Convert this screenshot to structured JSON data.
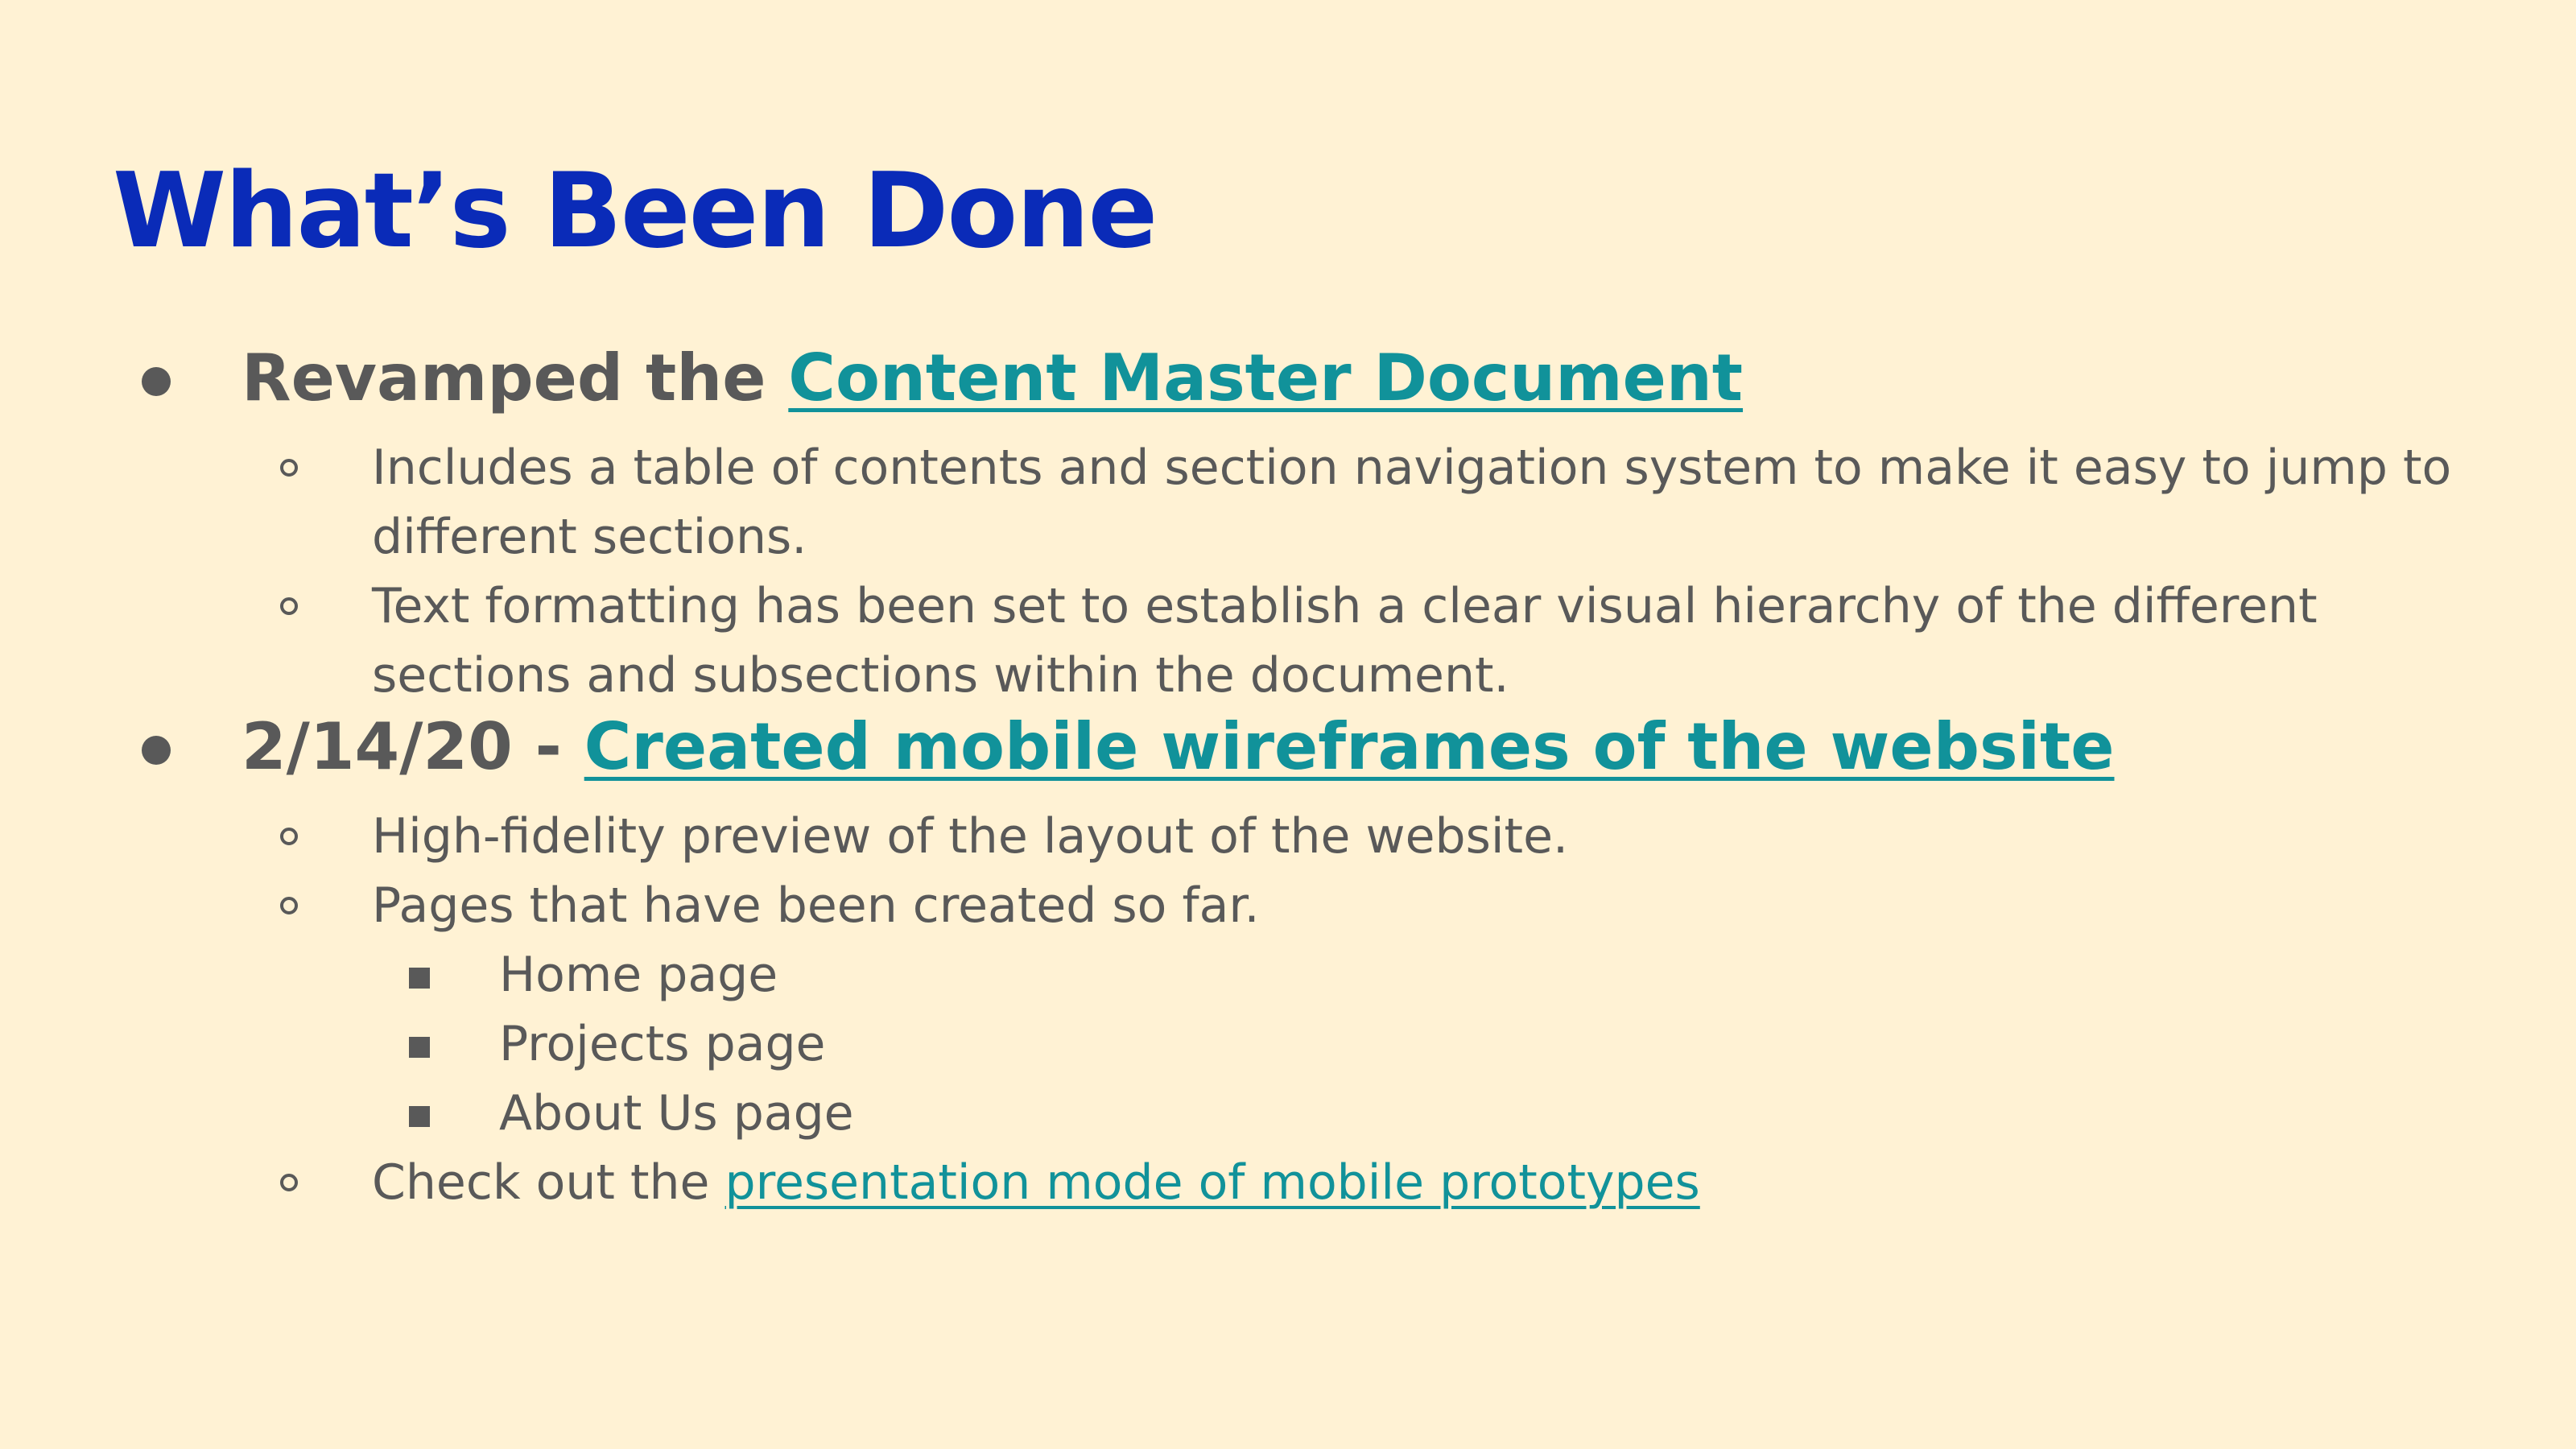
{
  "slide": {
    "title": "What’s Been Done",
    "bullets": [
      {
        "prefix": "Revamped the ",
        "link": "Content Master Document",
        "subs": [
          "Includes a table of contents and section navigation system to make it easy to jump to different sections.",
          "Text formatting has been set to establish a clear visual hierarchy of the different sections and subsections within the document."
        ]
      },
      {
        "prefix": "2/14/20 - ",
        "link": "Created mobile wireframes of the website",
        "subs": [
          "High-fidelity preview of the layout of the website.",
          "Pages that have been created so far."
        ],
        "pages": [
          "Home page",
          "Projects page",
          "About Us page"
        ],
        "last_sub_prefix": "Check out the ",
        "last_sub_link": "presentation mode of mobile prototypes"
      }
    ]
  },
  "colors": {
    "background": "#fff2d4",
    "title": "#0a2bb8",
    "body_text": "#595959",
    "link": "#11929a"
  },
  "icons": {
    "level1_marker": "filled-circle-bullet",
    "level2_marker": "hollow-circle-bullet",
    "level3_marker": "filled-square-bullet"
  }
}
